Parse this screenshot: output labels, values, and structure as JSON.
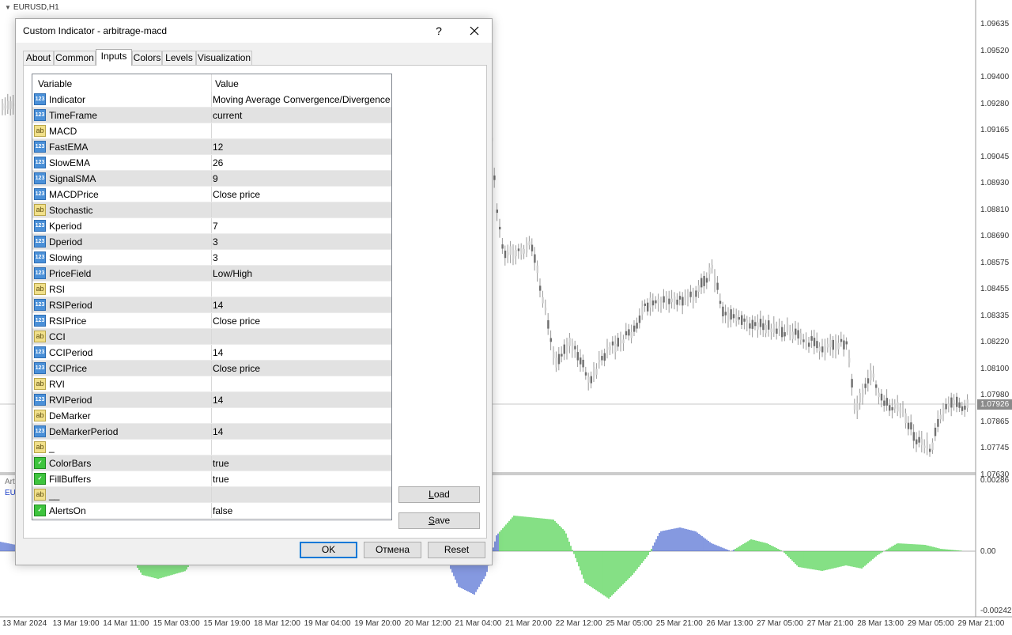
{
  "chart": {
    "title": "EURUSD,H1",
    "price_labels": [
      "1.09635",
      "1.09520",
      "1.09400",
      "1.09280",
      "1.09165",
      "1.09045",
      "1.08930",
      "1.08810",
      "1.08690",
      "1.08575",
      "1.08455",
      "1.08335",
      "1.08220",
      "1.08100",
      "1.07980",
      "1.07865",
      "1.07745",
      "1.07630"
    ],
    "current_price": "1.07926",
    "indicator_labels": [
      "0.00286",
      "0.00",
      "-0.00242"
    ],
    "time_labels": [
      "13 Mar 2024",
      "13 Mar 19:00",
      "14 Mar 11:00",
      "15 Mar 03:00",
      "15 Mar 19:00",
      "18 Mar 12:00",
      "19 Mar 04:00",
      "19 Mar 20:00",
      "20 Mar 12:00",
      "21 Mar 04:00",
      "21 Mar 20:00",
      "22 Mar 12:00",
      "25 Mar 05:00",
      "25 Mar 21:00",
      "26 Mar 13:00",
      "27 Mar 05:00",
      "27 Mar 21:00",
      "28 Mar 13:00",
      "29 Mar 05:00",
      "29 Mar 21:00"
    ],
    "subwindow_label_1": "Art",
    "subwindow_label_2": "EU"
  },
  "dialog": {
    "title": "Custom Indicator - arbitrage-macd",
    "help": "?",
    "tabs": [
      "About",
      "Common",
      "Inputs",
      "Colors",
      "Levels",
      "Visualization"
    ],
    "active_tab": "Inputs",
    "columns": {
      "variable": "Variable",
      "value": "Value"
    },
    "inputs": [
      {
        "type": "num",
        "var": "Indicator",
        "val": "Moving Average Convergence/Divergence"
      },
      {
        "type": "num",
        "var": "TimeFrame",
        "val": "current"
      },
      {
        "type": "str",
        "var": "MACD",
        "val": ""
      },
      {
        "type": "num",
        "var": "FastEMA",
        "val": "12"
      },
      {
        "type": "num",
        "var": "SlowEMA",
        "val": "26"
      },
      {
        "type": "num",
        "var": "SignalSMA",
        "val": "9"
      },
      {
        "type": "num",
        "var": "MACDPrice",
        "val": "Close price"
      },
      {
        "type": "str",
        "var": "Stochastic",
        "val": ""
      },
      {
        "type": "num",
        "var": "Kperiod",
        "val": "7"
      },
      {
        "type": "num",
        "var": "Dperiod",
        "val": "3"
      },
      {
        "type": "num",
        "var": "Slowing",
        "val": "3"
      },
      {
        "type": "num",
        "var": "PriceField",
        "val": "Low/High"
      },
      {
        "type": "str",
        "var": "RSI",
        "val": ""
      },
      {
        "type": "num",
        "var": "RSIPeriod",
        "val": "14"
      },
      {
        "type": "num",
        "var": "RSIPrice",
        "val": "Close price"
      },
      {
        "type": "str",
        "var": "CCI",
        "val": ""
      },
      {
        "type": "num",
        "var": "CCIPeriod",
        "val": "14"
      },
      {
        "type": "num",
        "var": "CCIPrice",
        "val": "Close price"
      },
      {
        "type": "str",
        "var": "RVI",
        "val": ""
      },
      {
        "type": "num",
        "var": "RVIPeriod",
        "val": "14"
      },
      {
        "type": "str",
        "var": "DeMarker",
        "val": ""
      },
      {
        "type": "num",
        "var": "DeMarkerPeriod",
        "val": "14"
      },
      {
        "type": "str",
        "var": "_",
        "val": ""
      },
      {
        "type": "bool",
        "var": "ColorBars",
        "val": "true"
      },
      {
        "type": "bool",
        "var": "FillBuffers",
        "val": "true"
      },
      {
        "type": "str",
        "var": "__",
        "val": ""
      },
      {
        "type": "bool",
        "var": "AlertsOn",
        "val": "false"
      }
    ],
    "buttons": {
      "load": "Load",
      "save": "Save",
      "ok": "OK",
      "cancel": "Отмена",
      "reset": "Reset"
    },
    "icon_names": {
      "num": "numeric-param-icon",
      "str": "string-param-icon",
      "bool": "boolean-param-icon"
    },
    "colors": {
      "histogram_green": "#33cc33",
      "histogram_blue": "#3355cc",
      "candles": "#808080"
    }
  }
}
